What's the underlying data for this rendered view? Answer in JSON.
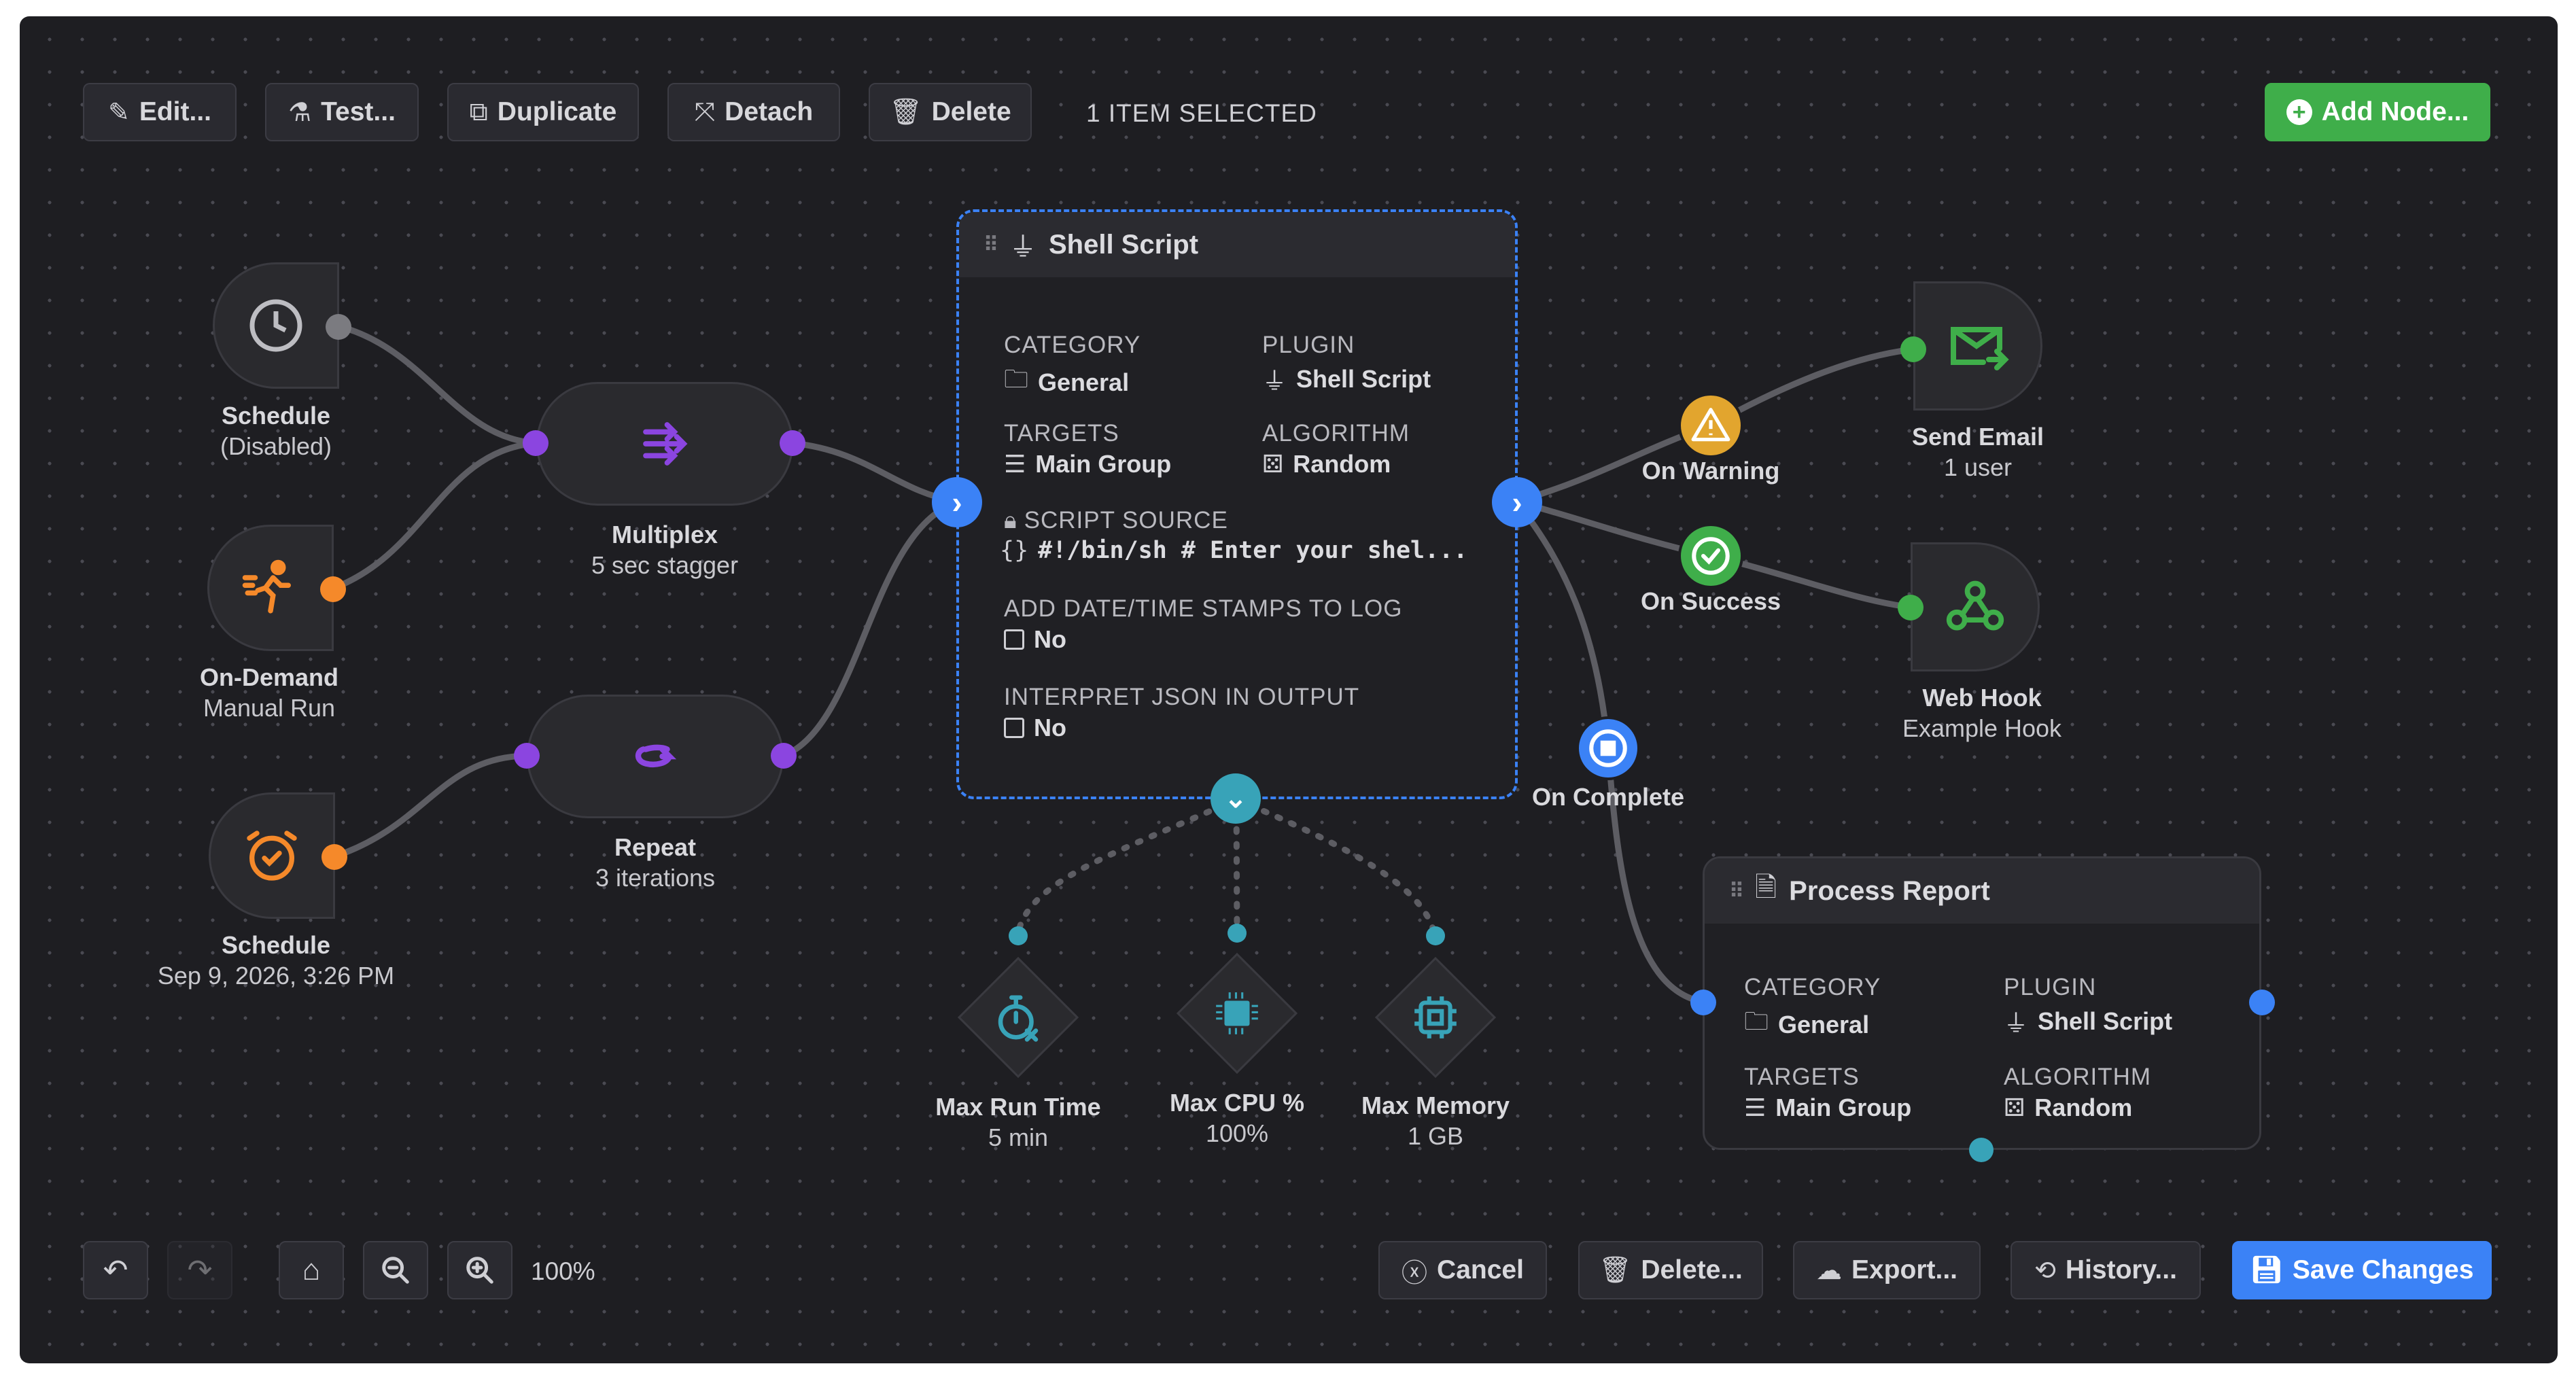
{
  "toolbar": {
    "edit": "Edit...",
    "test": "Test...",
    "duplicate": "Duplicate",
    "detach": "Detach",
    "delete": "Delete",
    "selection_status": "1 ITEM SELECTED",
    "add_node": "Add Node..."
  },
  "triggers": [
    {
      "title": "Schedule",
      "subtitle": "(Disabled)",
      "icon": "clock-icon"
    },
    {
      "title": "On-Demand",
      "subtitle": "Manual Run",
      "icon": "running-person-icon"
    },
    {
      "title": "Schedule",
      "subtitle": "Sep 9, 2026, 3:26 PM",
      "icon": "alarm-clock-icon"
    }
  ],
  "modifiers": [
    {
      "title": "Multiplex",
      "subtitle": "5 sec stagger",
      "icon": "shuffle-icon"
    },
    {
      "title": "Repeat",
      "subtitle": "3 iterations",
      "icon": "repeat-icon"
    }
  ],
  "main_job": {
    "title": "Shell Script",
    "category_label": "CATEGORY",
    "category_value": "General",
    "plugin_label": "PLUGIN",
    "plugin_value": "Shell Script",
    "targets_label": "TARGETS",
    "targets_value": "Main Group",
    "algorithm_label": "ALGORITHM",
    "algorithm_value": "Random",
    "script_label": "SCRIPT SOURCE",
    "script_value": "#!/bin/sh # Enter your shel...",
    "timestamps_label": "ADD DATE/TIME STAMPS TO LOG",
    "timestamps_value": "No",
    "json_label": "INTERPRET JSON IN OUTPUT",
    "json_value": "No"
  },
  "limits": [
    {
      "title": "Max Run Time",
      "subtitle": "5 min",
      "icon": "stopwatch-icon"
    },
    {
      "title": "Max CPU %",
      "subtitle": "100%",
      "icon": "cpu-chip-icon"
    },
    {
      "title": "Max Memory",
      "subtitle": "1 GB",
      "icon": "memory-chip-icon"
    }
  ],
  "conditions": [
    {
      "label": "On Warning",
      "icon": "warning-icon",
      "color": "#e2a52e"
    },
    {
      "label": "On Success",
      "icon": "check-circle-icon",
      "color": "#3fae4a"
    },
    {
      "label": "On Complete",
      "icon": "stop-circle-icon",
      "color": "#3b82f6"
    }
  ],
  "actions": [
    {
      "title": "Send Email",
      "subtitle": "1 user",
      "icon": "email-icon"
    },
    {
      "title": "Web Hook",
      "subtitle": "Example Hook",
      "icon": "webhook-icon"
    }
  ],
  "report_job": {
    "title": "Process Report",
    "category_label": "CATEGORY",
    "category_value": "General",
    "plugin_label": "PLUGIN",
    "plugin_value": "Shell Script",
    "targets_label": "TARGETS",
    "targets_value": "Main Group",
    "algorithm_label": "ALGORITHM",
    "algorithm_value": "Random"
  },
  "bottom_bar": {
    "zoom_level": "100%",
    "cancel": "Cancel",
    "delete": "Delete...",
    "export": "Export...",
    "history": "History...",
    "save": "Save Changes"
  },
  "colors": {
    "trigger_accent": "#f5892a",
    "modifier_accent": "#8b45e0",
    "connector_blue": "#3b82f6",
    "limit_accent": "#38a3b8",
    "action_green": "#3fae4a"
  }
}
